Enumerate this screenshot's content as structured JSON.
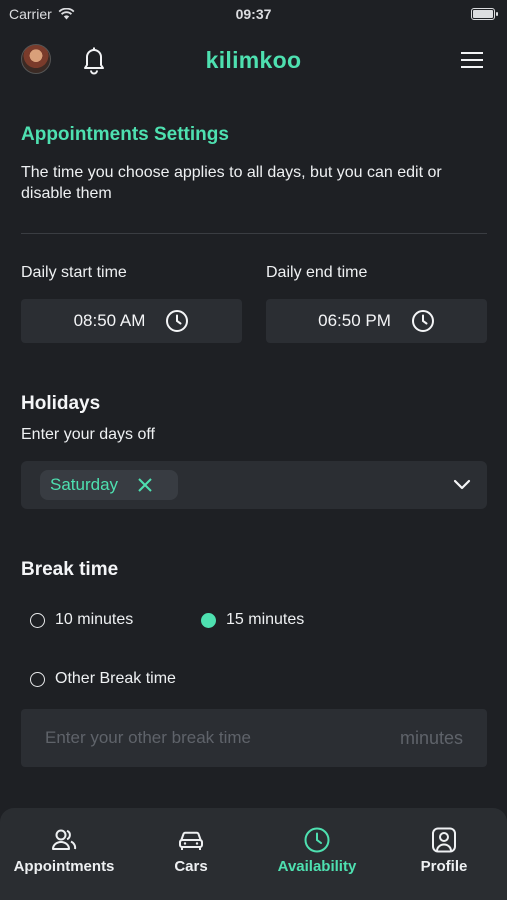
{
  "status_bar": {
    "carrier": "Carrier",
    "time": "09:37"
  },
  "header": {
    "brand": "kilimkoo"
  },
  "settings": {
    "title": "Appointments Settings",
    "description": "The time you choose applies to all days, but you can edit or disable them"
  },
  "daily_times": {
    "start_label": "Daily start time",
    "start_value": "08:50 AM",
    "end_label": "Daily end time",
    "end_value": "06:50 PM"
  },
  "holidays": {
    "title": "Holidays",
    "subtitle": "Enter your days off",
    "selected": [
      "Saturday"
    ]
  },
  "break_time": {
    "title": "Break time",
    "options": [
      {
        "label": "10 minutes",
        "checked": false
      },
      {
        "label": "15 minutes",
        "checked": true
      },
      {
        "label": "Other Break time",
        "checked": false
      }
    ],
    "other_placeholder": "Enter your other break time",
    "unit": "minutes"
  },
  "tabs": [
    {
      "label": "Appointments",
      "icon": "users-icon",
      "active": false
    },
    {
      "label": "Cars",
      "icon": "car-icon",
      "active": false
    },
    {
      "label": "Availability",
      "icon": "clock-icon",
      "active": true
    },
    {
      "label": "Profile",
      "icon": "profile-icon",
      "active": false
    }
  ],
  "colors": {
    "accent": "#4ee0b0",
    "background": "#1e2024",
    "surface": "#2b2e33"
  }
}
